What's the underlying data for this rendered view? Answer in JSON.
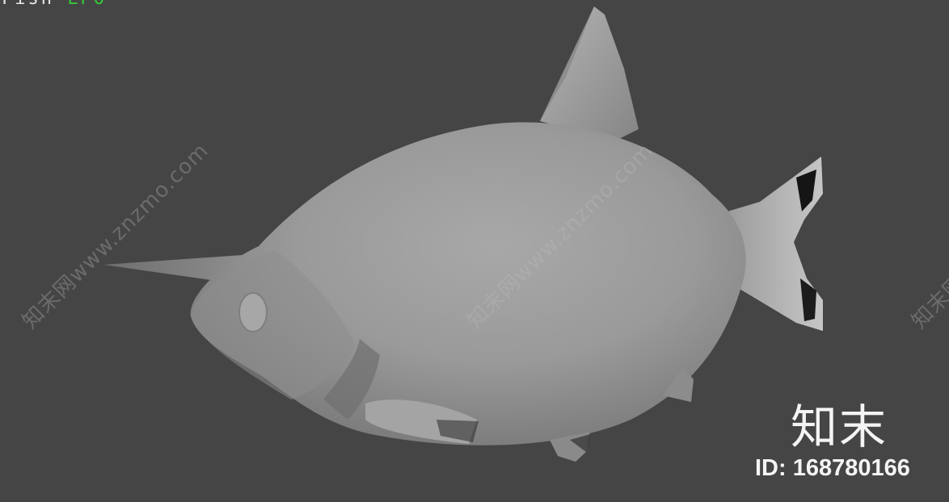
{
  "viewport": {
    "background": "#454545",
    "stats_label": "Fish",
    "stats_value": "LPO",
    "stats_label_color": "#e8e8e8",
    "stats_value_color": "#35c83a"
  },
  "model": {
    "subject": "fish-model",
    "surface_color": "#9a9a9a"
  },
  "watermarks": [
    "知末网www.znzmo.com",
    "知末网www.znzmo.com",
    "知末网www.znzmo.com"
  ],
  "brand": {
    "name": "知末",
    "id_text": "ID: 168780166"
  }
}
